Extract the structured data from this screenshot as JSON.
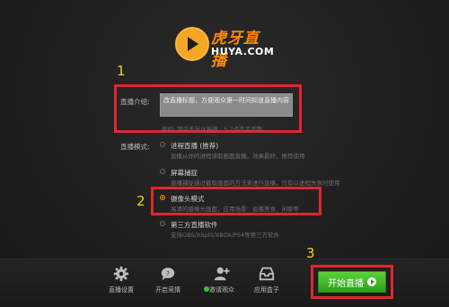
{
  "logo": {
    "cn": "虎牙直播",
    "en": "HUYA.COM"
  },
  "form": {
    "intro_label": "直播介绍:",
    "title_value": "改直播标题，方便观众第一时间知道直播内容",
    "example": "例如: 我今天玩IX英雄，5-7点不见不散。",
    "mode_label": "直播模式:"
  },
  "modes": [
    {
      "name": "进程直播 (推荐)",
      "desc": "直播从你的进程读取画面直播，效果最好，推荐使用",
      "selected": false
    },
    {
      "name": "屏幕捕捉",
      "desc": "直播捕捉通过截取画面的方法来进行直播，只有以进程失败时使用",
      "selected": false
    },
    {
      "name": "摄像头模式",
      "desc": "高清的摄像头画面，应用场景：直播美食、闲聊等",
      "selected": true
    },
    {
      "name": "第三方直播软件",
      "desc": "支持OBS/XSplit/XBOX/PS4等第三方软件",
      "selected": false
    }
  ],
  "annotations": {
    "n1": "1",
    "n2": "2",
    "n3": "3"
  },
  "toolbar": {
    "settings": "直播设置",
    "poll": "开启竞猜",
    "invite": "邀请观众",
    "apps": "应用盒子",
    "start": "开始直播"
  },
  "colors": {
    "accent": "#e0272d",
    "brand": "#ff8a00",
    "start": "#3bb826",
    "highlight": "#f2d21b"
  },
  "icons": {
    "settings": "gear-icon",
    "poll": "chat-bubble-icon",
    "invite": "add-user-icon",
    "apps": "tray-icon",
    "start": "play-circle-icon"
  }
}
